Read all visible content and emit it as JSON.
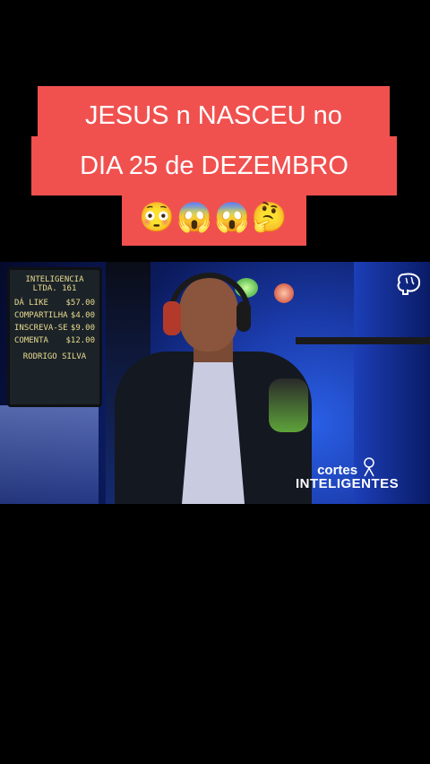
{
  "caption": {
    "line1": "JESUS n NASCEU no",
    "line2": "DIA 25 de DEZEMBRO",
    "line3": "😳😱😱🤔"
  },
  "sign": {
    "title": "INTELIGENCIA",
    "subtitle": "LTDA. 161",
    "rows": [
      {
        "label": "DÁ LIKE",
        "price": "$57.00"
      },
      {
        "label": "COMPARTILHA",
        "price": "$4.00"
      },
      {
        "label": "INSCREVA-SE",
        "price": "$9.00"
      },
      {
        "label": "COMENTA",
        "price": "$12.00"
      }
    ],
    "footer": "RODRIGO SILVA"
  },
  "watermark": {
    "line1": "cortes",
    "line2": "INTELIGENTES"
  },
  "colors": {
    "caption_bg": "#f0514f",
    "page_bg": "#000000"
  }
}
